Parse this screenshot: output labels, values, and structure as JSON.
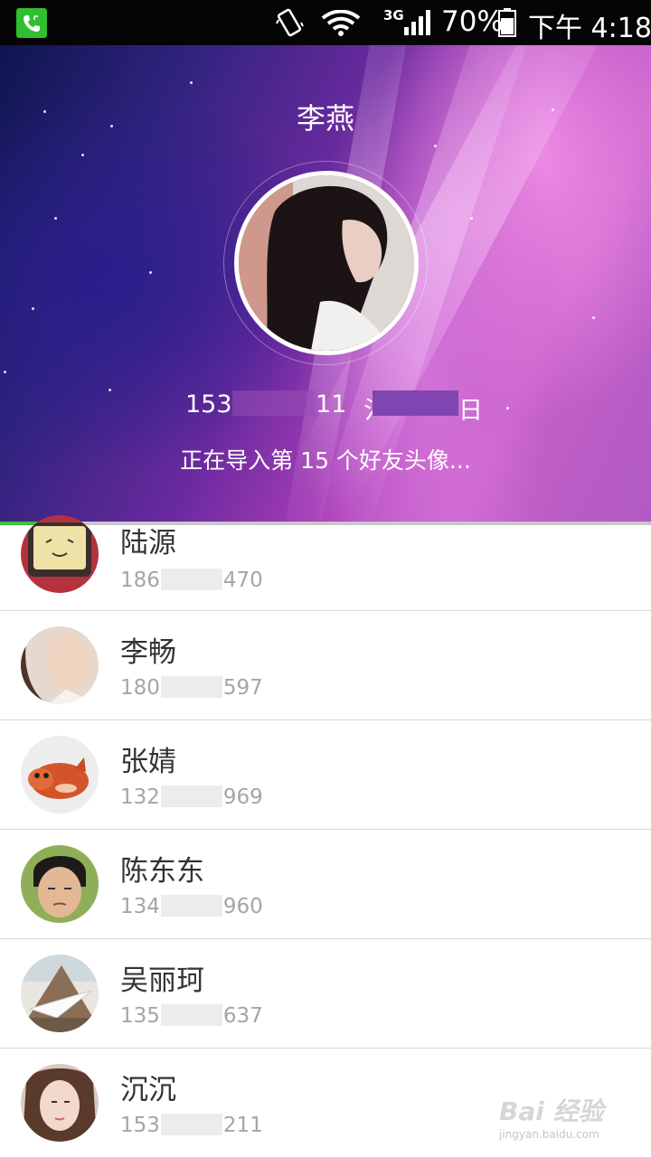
{
  "status_bar": {
    "network": "3G",
    "battery": "70%",
    "time": "下午 4:18",
    "icons": [
      "phone-call-icon",
      "vibrate-icon",
      "wifi-icon",
      "signal-icon",
      "battery-icon"
    ]
  },
  "header": {
    "name": "李燕",
    "phone_parts": [
      "153",
      "11",
      "氵",
      "日"
    ],
    "import_status": "正在导入第 15 个好友头像..."
  },
  "progress": {
    "fraction": 0.12
  },
  "contacts": [
    {
      "name": "陆源",
      "phone_prefix": "186",
      "phone_suffix": "470"
    },
    {
      "name": "李畅",
      "phone_prefix": "180",
      "phone_suffix": "597"
    },
    {
      "name": "张婧",
      "phone_prefix": "132",
      "phone_suffix": "969"
    },
    {
      "name": "陈东东",
      "phone_prefix": "134",
      "phone_suffix": "960"
    },
    {
      "name": "吴丽珂",
      "phone_prefix": "135",
      "phone_suffix": "637"
    },
    {
      "name": "沉沉",
      "phone_prefix": "153",
      "phone_suffix": "211"
    }
  ],
  "watermark": {
    "brand": "Bai 经验",
    "url": "jingyan.baidu.com"
  },
  "colors": {
    "accent": "#3cc23c",
    "status_bar": "#050505",
    "call_icon": "#2fbf2f"
  }
}
